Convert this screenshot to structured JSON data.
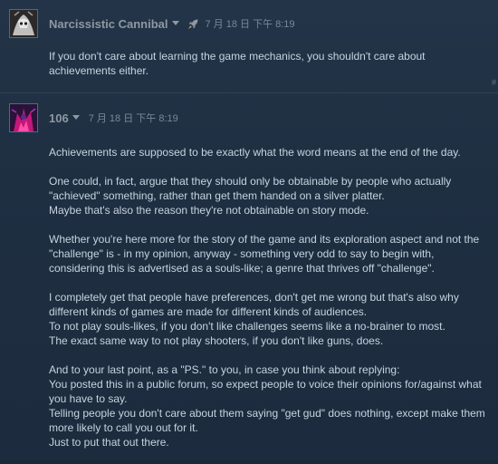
{
  "posts": [
    {
      "author": "Narcissistic Cannibal",
      "timestamp": "7 月 18 日 下午 8:19",
      "badge_icon": "rocket-icon",
      "paragraphs": [
        [
          "If you don't care about learning the game mechanics, you shouldn't care about",
          "achievements either."
        ]
      ],
      "hash": "#"
    },
    {
      "author": "106",
      "timestamp": "7 月 18 日 下午 8:19",
      "paragraphs": [
        [
          "Achievements are supposed to be exactly what the word means at the end of the day."
        ],
        [
          "One could, in fact, argue that they should only be obtainable by people who actually",
          "\"achieved\" something, rather than get them handed on a silver platter.",
          "Maybe that's also the reason they're not obtainable on story mode."
        ],
        [
          "Whether you're here more for the story of the game and its exploration aspect and not the",
          "\"challenge\" is - in my opinion, anyway - something very odd to say to begin with,",
          "considering this is advertised as a souls-like; a genre that thrives off \"challenge\"."
        ],
        [
          "I completely get that people have preferences, don't get me wrong but that's also why",
          "different kinds of games are made for different kinds of audiences.",
          "To not play souls-likes, if you don't like challenges seems like a no-brainer to most.",
          "The exact same way to not play shooters, if you don't like guns, does."
        ],
        [
          "And to your last point, as a \"PS.\" to you, in case you think about replying:",
          "You posted this in a public forum, so expect people to voice their opinions for/against what",
          "you have to say.",
          "Telling people you don't care about them saying \"get gud\" does nothing, except make them",
          "more likely to call you out for it.",
          "Just to put that out there."
        ]
      ]
    }
  ]
}
